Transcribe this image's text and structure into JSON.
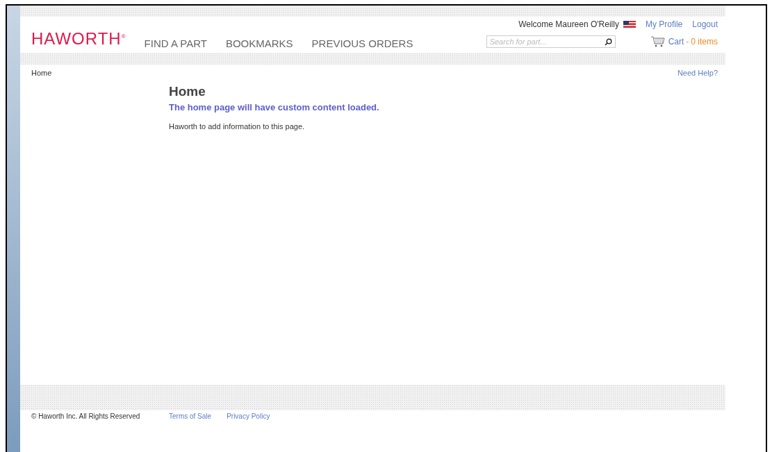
{
  "logo": "HAWORTH",
  "logo_mark": "®",
  "nav": [
    {
      "label": "FIND A PART"
    },
    {
      "label": "BOOKMARKS"
    },
    {
      "label": "PREVIOUS ORDERS"
    }
  ],
  "welcome": "Welcome Maureen O'Reilly",
  "user_links": [
    "My Profile",
    "Logout"
  ],
  "search": {
    "placeholder": "Search for part..."
  },
  "cart": {
    "label": "Cart",
    "separator": "-",
    "count": "0 items"
  },
  "breadcrumb": "Home",
  "help": "Need Help?",
  "content": {
    "title": "Home",
    "subtitle": "The home page will have custom content loaded.",
    "body": "Haworth to add information to this page."
  },
  "footer": {
    "copyright": "© Haworth Inc. All Rights Reserved",
    "links": [
      "Terms of Sale",
      "Privacy Policy"
    ]
  }
}
